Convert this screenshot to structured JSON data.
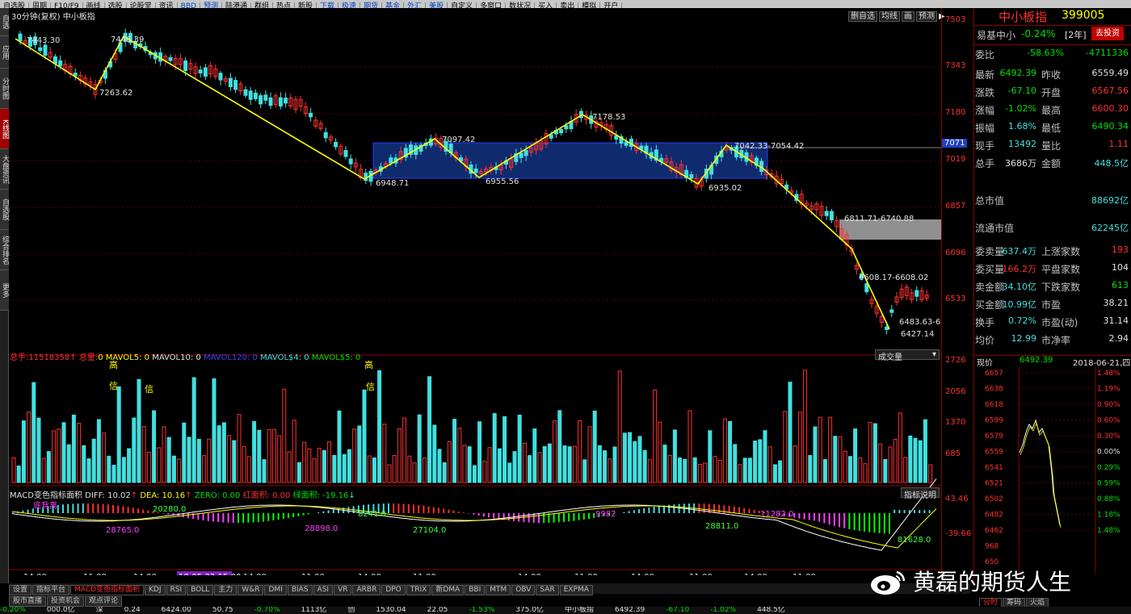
{
  "menu": [
    "自选股",
    "周期",
    "F10/F9",
    "画线",
    "选股",
    "论股堂",
    "资讯",
    "BBD",
    "预测",
    "陆港通",
    "群组",
    "热点",
    "新股",
    "下载",
    "极速",
    "期货",
    "基金",
    "外汇",
    "美股",
    "自定义",
    "多窗口",
    "数状况",
    "买入",
    "卖出",
    "模拟",
    "开户"
  ],
  "left_tabs": [
    "自选",
    "应用",
    "分时图",
    "K线图",
    "大盘资讯",
    "自选股",
    "综合排名",
    "更多"
  ],
  "left_tab_active": "K线图",
  "chart": {
    "header_left": "30分钟(复权)  中小板指",
    "header_buttons": [
      "删自选",
      "均线",
      "画",
      "预测"
    ],
    "zigzag_labels": [
      "7443.30",
      "7446.39",
      "7263.62",
      "6948.71",
      "7097.42",
      "6955.56",
      "7178.53",
      "6935.02",
      "7042.33-7054.42",
      "6811.71-6740.88",
      "6608.17-6608.02",
      "6483.63-6",
      "6427.14"
    ],
    "price_axis": [
      "7503",
      "7343",
      "7180",
      "7071",
      "7019",
      "6857",
      "6696",
      "6533"
    ],
    "vol_header": {
      "zs_label": "总手:",
      "zs": "11518358",
      "zl_label": "总量:",
      "zl": "0",
      "mavol5": "MAVOL5: 0",
      "mavol10": "MAVOL10: 0",
      "mavol120": "MAVOL120: 0",
      "mavol4": "MAVOL$4: 0",
      "mavol5b": "MAVOL$5: 0",
      "dropdown": "成交量"
    },
    "vol_axis": [
      "2726",
      "2056",
      "1370",
      "685"
    ],
    "vol_marks": [
      "高",
      "信",
      "信",
      "高",
      "信"
    ],
    "macd_header": {
      "name": "MACD变色指标面积",
      "diff": "DIFF: 10.02",
      "dea": "DEA: 10.16",
      "zero": "ZERO: 0.00",
      "red": "红面积: 0.00",
      "green": "绿面积: -19.16",
      "button": "指标说明"
    },
    "macd_axis": [
      "43.46",
      "-39.66"
    ],
    "macd_labels": [
      "底背离",
      "20280.0",
      "28765.0",
      "8241.0",
      "28898.0",
      "27104.0",
      "9982",
      "28811.0",
      "11282.0",
      "81628.0"
    ],
    "time_axis": [
      "14:00",
      "11:00",
      "14:00",
      "18-05-22 15:00",
      "14:00",
      "11:00",
      "14:00",
      "11:00",
      "14:00",
      "11:00",
      "14:00",
      "11:00",
      "14:00",
      "11:00"
    ]
  },
  "right_panel": {
    "title": "中小板指",
    "code": "399005",
    "sub_name": "易基中小",
    "sub_change": "-0.24%",
    "sub_tag": "[2年]",
    "invest_button": "去投资",
    "weibi_label": "委比",
    "weibi": "-58.63%",
    "weicha": "-4711336",
    "rows": [
      {
        "l": "最新",
        "v1": "6492.39",
        "c1": "g",
        "l2": "昨收",
        "v2": "6559.49",
        "c2": "w"
      },
      {
        "l": "涨跌",
        "v1": "-67.10",
        "c1": "g",
        "l2": "开盘",
        "v2": "6567.56",
        "c2": "r"
      },
      {
        "l": "涨幅",
        "v1": "-1.02%",
        "c1": "g",
        "l2": "最高",
        "v2": "6600.30",
        "c2": "r"
      },
      {
        "l": "振幅",
        "v1": "1.68%",
        "c1": "c",
        "l2": "最低",
        "v2": "6490.34",
        "c2": "g"
      },
      {
        "l": "现手",
        "v1": "13492",
        "c1": "c",
        "l2": "量比",
        "v2": "1.11",
        "c2": "r"
      },
      {
        "l": "总手",
        "v1": "3686万",
        "c1": "w",
        "l2": "金额",
        "v2": "448.5亿",
        "c2": "c"
      }
    ],
    "total_mv_label": "总市值",
    "total_mv": "88692亿",
    "float_mv_label": "流通市值",
    "float_mv": "62245亿",
    "rows2": [
      {
        "l": "委卖量",
        "v1": "637.4万",
        "c1": "c",
        "l2": "上涨家数",
        "v2": "193",
        "c2": "r"
      },
      {
        "l": "委买量",
        "v1": "166.2万",
        "c1": "r",
        "l2": "平盘家数",
        "v2": "104",
        "c2": "w"
      },
      {
        "l": "卖金额",
        "v1": "34.10亿",
        "c1": "c",
        "l2": "下跌家数",
        "v2": "613",
        "c2": "g"
      },
      {
        "l": "买金额",
        "v1": "10.99亿",
        "c1": "c",
        "l2": "市盈",
        "v2": "38.21",
        "c2": "w"
      },
      {
        "l": "换手",
        "v1": "0.72%",
        "c1": "c",
        "l2": "市盈(动)",
        "v2": "31.14",
        "c2": "w"
      },
      {
        "l": "均价",
        "v1": "12.99",
        "c1": "c",
        "l2": "市净率",
        "v2": "2.94",
        "c2": "w"
      }
    ],
    "mini": {
      "label": "现价",
      "price": "6492.39",
      "date": "2018-06-21,四",
      "left_axis": [
        "6657",
        "6638",
        "6618",
        "6599",
        "6579",
        "6559",
        "6541",
        "6521",
        "6502",
        "6482",
        "6462",
        "968",
        "650"
      ],
      "right_axis": [
        "1.48%",
        "1.19%",
        "0.90%",
        "0.60%",
        "0.30%",
        "0.00%",
        "0.29%",
        "0.59%",
        "0.88%",
        "1.18%",
        "1.48%"
      ]
    },
    "mini_tabs": [
      "分时",
      "筹码",
      "火焰"
    ]
  },
  "indicator_tabs": [
    "设置",
    "指标平台",
    "MACD变色指标面积",
    "KDJ",
    "RSI",
    "BOLL",
    "主力",
    "W&R",
    "DMI",
    "BIAS",
    "ASI",
    "VR",
    "ARBR",
    "DPO",
    "TRIX",
    "新DMA",
    "BBI",
    "MTM",
    "OBV",
    "SAR",
    "EXPMA"
  ],
  "bottom_tabs": [
    "股市直播",
    "投资机会",
    "观点评论"
  ],
  "ticker": [
    "-0.20%",
    "000.0亿",
    "深",
    "0.24",
    "6424.00",
    "50.75",
    "-0.70%",
    "1113亿",
    "创",
    "1530.04",
    "22.05",
    "-1.53%",
    "375.0亿",
    "中小板指",
    "6492.39",
    "-67.10",
    "-1.02%",
    "448.5亿"
  ],
  "watermark": "黄磊的期货人生"
}
